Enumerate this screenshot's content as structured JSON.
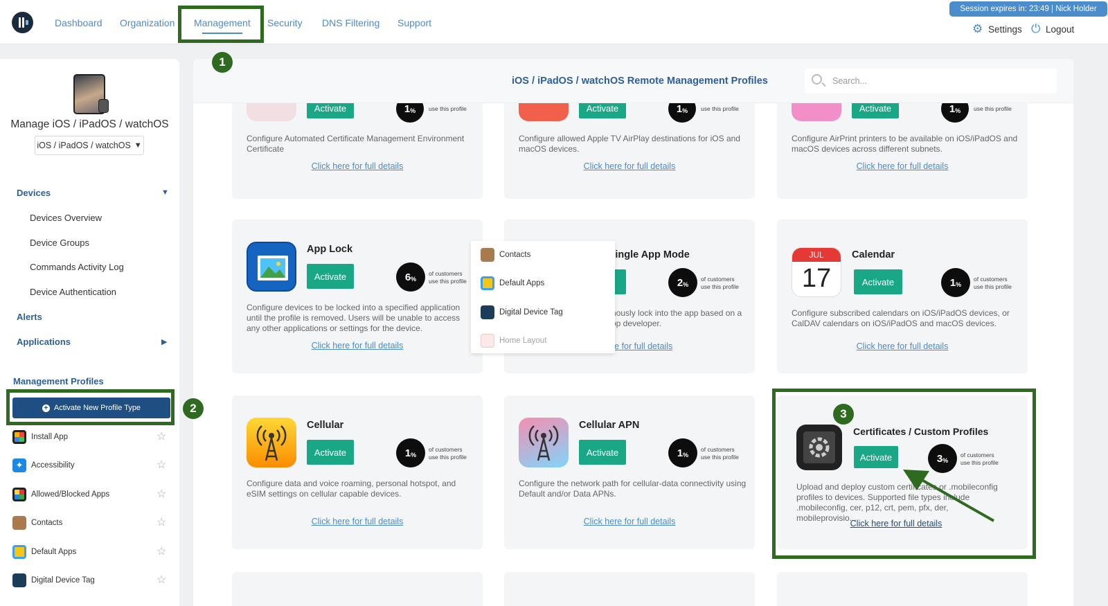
{
  "nav": {
    "items": [
      "Dashboard",
      "Organization",
      "Management",
      "Security",
      "DNS Filtering",
      "Support"
    ],
    "active": "Management",
    "session": "Session expires in: 23:49 | Nick Holder",
    "settings": "Settings",
    "logout": "Logout"
  },
  "sidebar": {
    "title": "Manage iOS / iPadOS / watchOS",
    "os_select": "iOS / iPadOS / watchOS",
    "devices": "Devices",
    "devices_sub": [
      "Devices Overview",
      "Device Groups",
      "Commands Activity Log",
      "Device Authentication"
    ],
    "alerts": "Alerts",
    "applications": "Applications",
    "mgmt_profiles": "Management Profiles",
    "activate_new": "Activate New Profile Type",
    "profiles": [
      "Install App",
      "Accessibility",
      "Allowed/Blocked Apps",
      "Contacts",
      "Default Apps",
      "Digital Device Tag"
    ]
  },
  "main": {
    "title": "iOS / iPadOS / watchOS Remote Management Profiles",
    "search_placeholder": "Search...",
    "activate": "Activate",
    "of_customers": "of customers",
    "use_profile": "use this profile",
    "details": "Click here for full details",
    "top_cards": [
      {
        "pct": "1",
        "desc": "Configure Automated Certificate Management Environment Certificate"
      },
      {
        "pct": "1",
        "desc": "Configure allowed Apple TV AirPlay destinations for iOS and macOS devices."
      },
      {
        "pct": "1",
        "desc": "Configure AirPrint printers to be available on iOS/iPadOS and macOS devices across different subnets."
      }
    ],
    "row2": [
      {
        "title": "App Lock",
        "pct": "6",
        "desc": "Configure devices to be locked into a specified application until the profile is removed. Users will be unable to access any other applications or settings for the device."
      },
      {
        "title": "mous Single App Mode",
        "pct": "2",
        "desc": "nously lock into the app based on a\npp developer."
      },
      {
        "title": "Calendar",
        "pct": "1",
        "desc": "Configure subscribed calendars on iOS/iPadOS devices, or CalDAV calendars on iOS/iPadOS and macOS devices.",
        "month": "JUL",
        "day": "17"
      }
    ],
    "row3": [
      {
        "title": "Cellular",
        "pct": "1",
        "desc": "Configure data and voice roaming, personal hotspot, and eSIM settings on cellular capable devices."
      },
      {
        "title": "Cellular APN",
        "pct": "1",
        "desc": "Configure the network path for cellular-data connectivity using Default and/or Data APNs."
      },
      {
        "title": "Certificates / Custom Profiles",
        "pct": "3",
        "desc": "Upload and deploy custom certificates or .mobileconfig profiles to devices. Supported file types include .mobileconfig, cer, p12, crt, pem, pfx, der, mobileprovisio..."
      }
    ]
  },
  "dropdown": [
    "Contacts",
    "Default Apps",
    "Digital Device Tag",
    "Home Layout"
  ],
  "annotations": [
    "1",
    "2",
    "3"
  ],
  "colors": {
    "accent": "#4a8ccc",
    "activate": "#1aa785",
    "highlight": "#2e6a1f",
    "nav_dark": "#1f4e82"
  }
}
